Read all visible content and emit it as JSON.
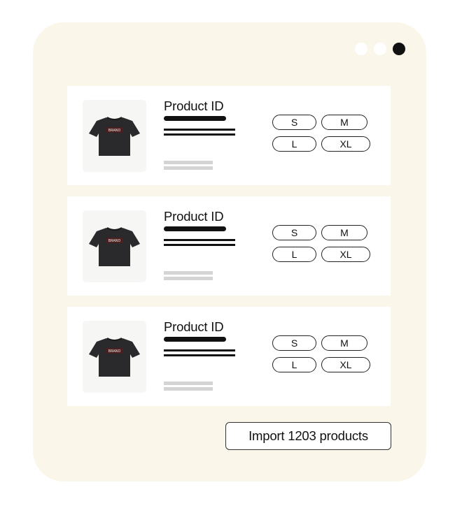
{
  "window": {
    "dots": [
      "dot",
      "dot",
      "dot-active"
    ]
  },
  "products": [
    {
      "title": "Product ID",
      "brand_text": "BRAND",
      "sizes": {
        "s": "S",
        "m": "M",
        "l": "L",
        "xl": "XL"
      }
    },
    {
      "title": "Product ID",
      "brand_text": "BRAND",
      "sizes": {
        "s": "S",
        "m": "M",
        "l": "L",
        "xl": "XL"
      }
    },
    {
      "title": "Product ID",
      "brand_text": "BRAND",
      "sizes": {
        "s": "S",
        "m": "M",
        "l": "L",
        "xl": "XL"
      }
    }
  ],
  "import_button": {
    "label": "Import 1203 products"
  },
  "colors": {
    "background": "#faf6ea",
    "accent": "#111111",
    "placeholder": "#d4d4d4"
  }
}
